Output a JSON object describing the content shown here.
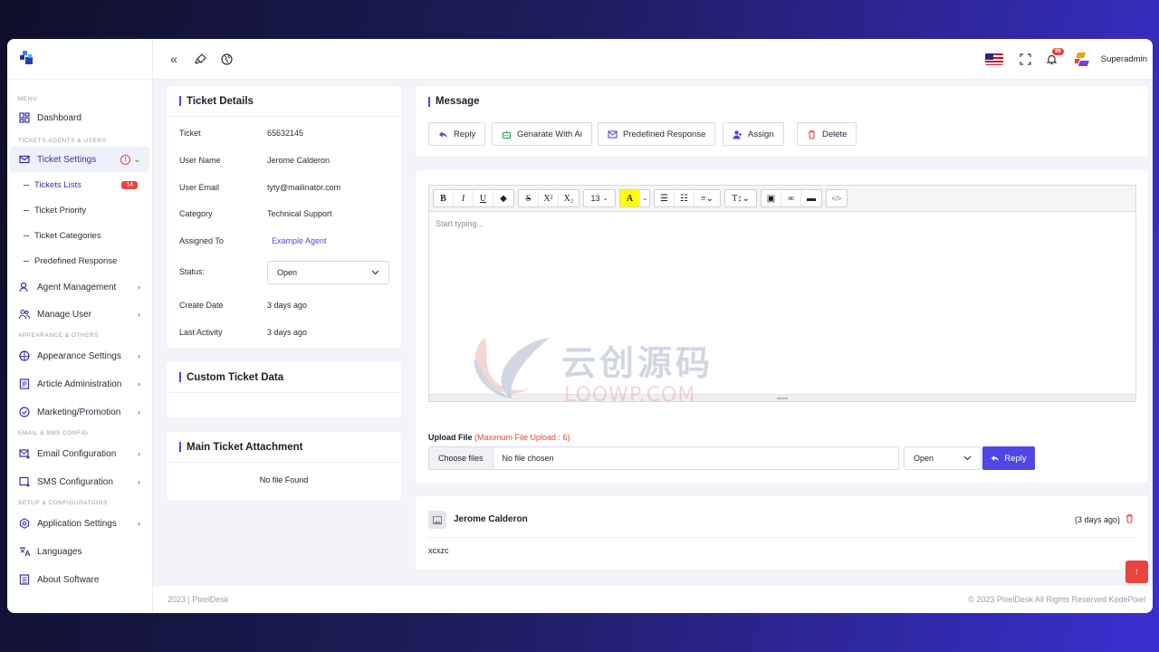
{
  "sidebar": {
    "sections": {
      "menu": "MENU",
      "tickets": "TICKETS,AGENTS & USERS",
      "appearance": "APPEARANCE & OTHERS",
      "email": "EMAIL & SMS CONFIG",
      "setup": "SETUP & CONFIGURATIONS"
    },
    "dashboard": "Dashboard",
    "ticket_settings": "Ticket Settings",
    "tickets_lists": "Tickets Lists",
    "tickets_lists_badge": "14",
    "ticket_priority": "Ticket Priority",
    "ticket_categories": "Ticket Categories",
    "predefined_response": "Predefined Response",
    "agent_management": "Agent Management",
    "manage_user": "Manage User",
    "appearance_settings": "Appearance Settings",
    "article_administration": "Article Administration",
    "marketing_promotion": "Marketing/Promotion",
    "email_configuration": "Email Configuration",
    "sms_configuration": "SMS Configuration",
    "application_settings": "Application Settings",
    "languages": "Languages",
    "about_software": "About Software"
  },
  "topbar": {
    "notification_count": "99",
    "user_name": "Superadmin"
  },
  "ticket_details": {
    "title": "Ticket Details",
    "ticket_label": "Ticket",
    "ticket_value": "65632145",
    "user_name_label": "User Name",
    "user_name_value": "Jerome Calderon",
    "user_email_label": "User Email",
    "user_email_value": "tyty@mailinator.com",
    "category_label": "Category",
    "category_value": "Technical Support",
    "assigned_label": "Assigned To",
    "assigned_value": "Example Agent",
    "status_label": "Status:",
    "status_value": "Open",
    "create_label": "Create Date",
    "create_value": "3 days ago",
    "activity_label": "Last Activity",
    "activity_value": "3 days ago"
  },
  "custom_data": {
    "title": "Custom Ticket Data"
  },
  "attachment": {
    "title": "Main Ticket Attachment",
    "empty": "No file Found"
  },
  "message": {
    "title": "Message",
    "buttons": {
      "reply": "Reply",
      "generate": "Genarate With Ai",
      "predefined": "Predefined Response",
      "assign": "Assign",
      "delete": "Delete"
    }
  },
  "editor": {
    "font_size": "13",
    "placeholder": "Start typing..."
  },
  "upload": {
    "label": "Upload File",
    "limit": "(Maximum File Upload : 6)",
    "choose": "Choose files",
    "none": "No file chosen",
    "status": "Open",
    "reply": "Reply"
  },
  "reply_item": {
    "author": "Jerome Calderon",
    "time": "(3 days ago)",
    "body": "xcxzc"
  },
  "footer": {
    "left": "2023 | PixelDesk",
    "right": "© 2023 PixelDesk All Rights Reserved KodePixel"
  },
  "watermark": {
    "cn": "云创源码",
    "en": "LOOWP.COM"
  },
  "colors": {
    "accent": "#4f46e5",
    "danger": "#e8453c"
  }
}
